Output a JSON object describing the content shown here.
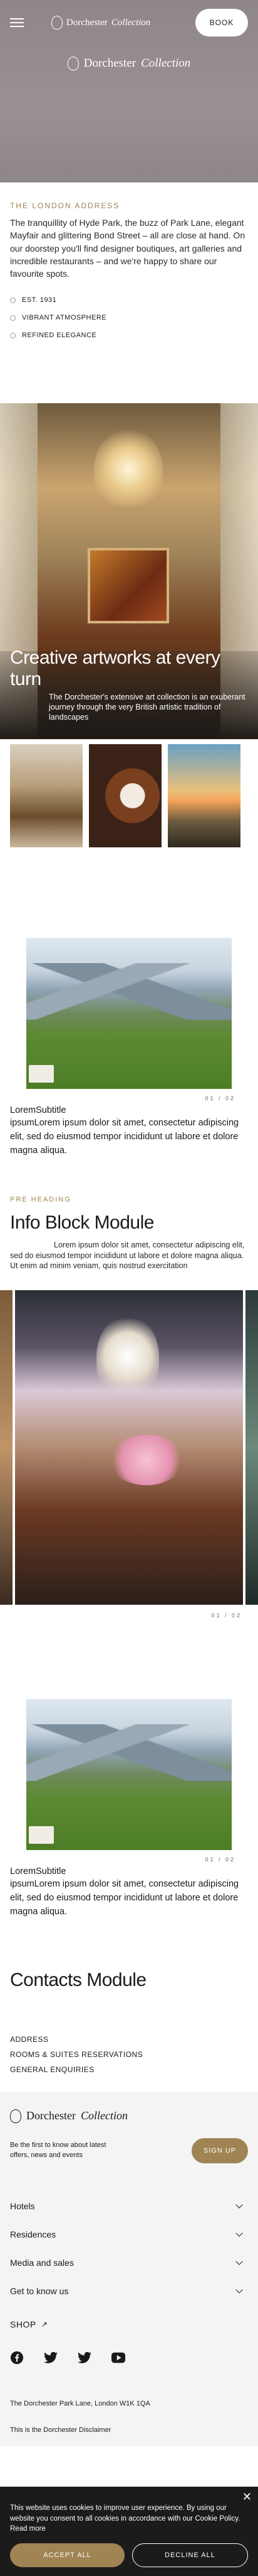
{
  "header": {
    "brand": "Dorchester",
    "brand_italic": "Collection",
    "book_label": "BOOK"
  },
  "hero": {
    "brand": "Dorchester",
    "brand_italic": "Collection"
  },
  "intro": {
    "eyebrow": "THE LONDON ADDRESS",
    "text": "The tranquillity of Hyde Park, the buzz of Park Lane, elegant Mayfair and glittering Bond Street – all are close at hand. On our doorstep you'll find designer boutiques, art galleries and incredible restaurants – and we're happy to share our favourite spots.",
    "bullets": [
      "EST. 1931",
      "VIBRANT ATMOSPHERE",
      "REFINED ELEGANCE"
    ]
  },
  "gallery": {
    "title": "Creative artworks at every turn",
    "caption": "The Dorchester's extensive art collection is an exuberant journey through the very British artistic tradition of landscapes"
  },
  "text_image_1": {
    "pager": "01 / 02",
    "subtitle": "LoremSubtitle",
    "body": "ipsumLorem ipsum dolor sit amet, consectetur adipiscing elit, sed do eiusmod tempor incididunt ut labore et dolore magna aliqua."
  },
  "info_block": {
    "pre_heading": "PRE HEADING",
    "title": "Info Block Module",
    "text": "Lorem ipsum dolor sit amet, consectetur adipiscing elit, sed do eiusmod tempor incididunt ut labore et dolore magna aliqua. Ut enim ad minim veniam, quis nostrud exercitation",
    "pager": "01 / 02"
  },
  "text_image_2": {
    "pager": "01 / 02",
    "subtitle": "LoremSubtitle",
    "body": "ipsumLorem ipsum dolor sit amet, consectetur adipiscing elit, sed do eiusmod tempor incididunt ut labore et dolore magna aliqua."
  },
  "contacts": {
    "title": "Contacts Module",
    "links": [
      "ADDRESS",
      "ROOMS & SUITES RESERVATIONS",
      "GENERAL ENQUIRIES"
    ]
  },
  "footer": {
    "brand": "Dorchester",
    "brand_italic": "Collection",
    "signup_text": "Be the first to know about latest offers, news and events",
    "signup_label": "SIGN UP",
    "nav": [
      "Hotels",
      "Residences",
      "Media and sales",
      "Get to know us"
    ],
    "shop": "SHOP",
    "socials": [
      "facebook-icon",
      "twitter-icon",
      "twitter-icon",
      "youtube-icon"
    ],
    "address": "The Dorchester Park Lane, London W1K 1QA",
    "disclaimer": "This is the Dorchester Disclaimer"
  },
  "cookie": {
    "text": "This website uses cookies to improve user experience. By using our website you consent to all cookies in accordance with our Cookie Policy. Read more",
    "accept": "ACCEPT ALL",
    "decline": "DECLINE ALL"
  },
  "colors": {
    "accent": "#a08454",
    "hero_bg": "#918889",
    "cookie_bg": "#1b1b1b"
  }
}
